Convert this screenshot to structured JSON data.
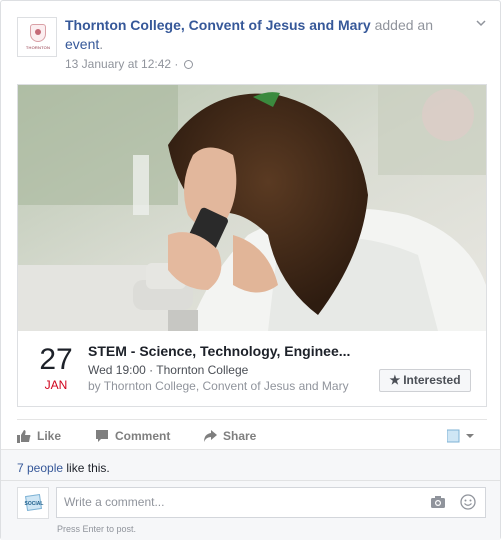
{
  "post": {
    "page_name": "Thornton College, Convent of Jesus and Mary",
    "action_text": "added an",
    "object_text": "event",
    "timestamp": "13 January at 12:42",
    "avatar_text": "THORNTON"
  },
  "event": {
    "day": "27",
    "month": "JAN",
    "title": "STEM - Science, Technology, Enginee...",
    "when": "Wed 19:00 · Thornton College",
    "by": "by Thornton College, Convent of Jesus and Mary",
    "interested_label": "Interested"
  },
  "actions": {
    "like": "Like",
    "comment": "Comment",
    "share": "Share"
  },
  "likes": {
    "people": "7 people",
    "suffix": "like this."
  },
  "comment_box": {
    "placeholder": "Write a comment...",
    "hint": "Press Enter to post.",
    "avatar_text": "SOCIAL"
  },
  "colors": {
    "link": "#365899",
    "muted": "#90949c",
    "month_red": "#d0021b"
  }
}
